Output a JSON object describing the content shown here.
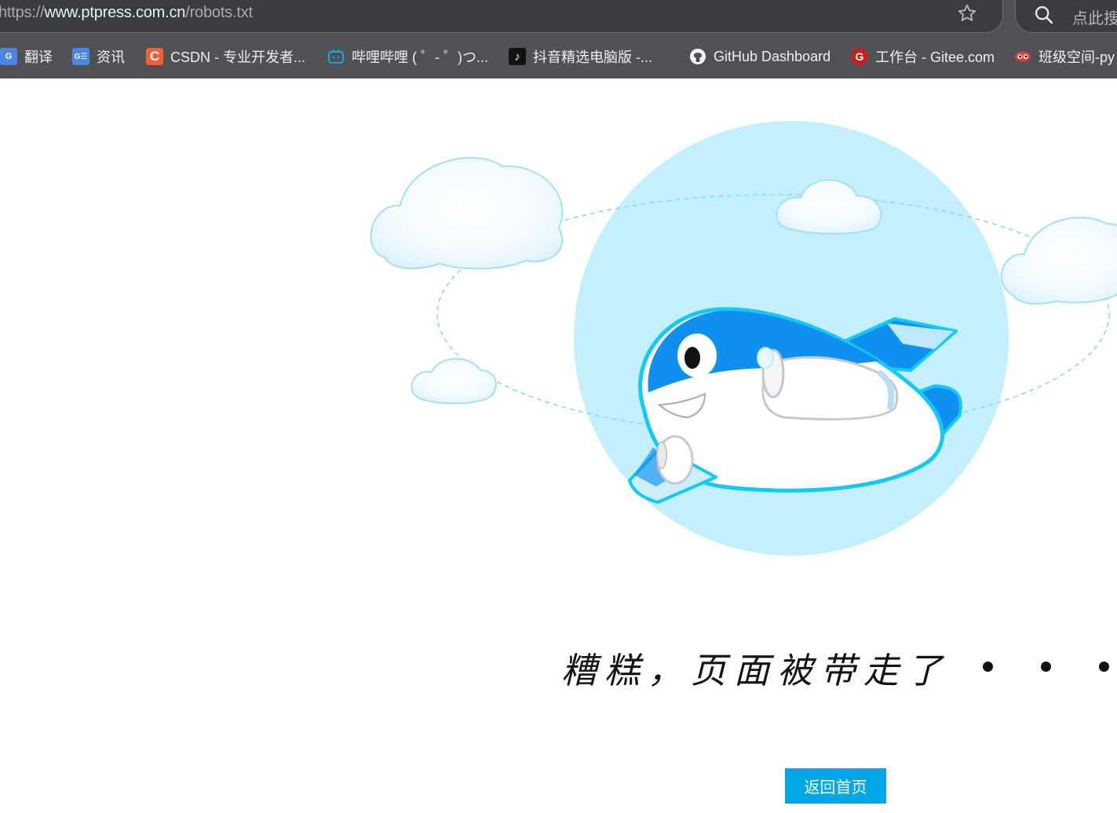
{
  "browser": {
    "url_scheme": "https://",
    "url_host": "www.ptpress.com.cn",
    "url_path": "/robots.txt",
    "search_placeholder": "点此搜"
  },
  "bookmarks": [
    {
      "label": "翻译",
      "icon": "google-translate-icon",
      "color": "#4a86e8"
    },
    {
      "label": "资讯",
      "icon": "google-news-icon",
      "color": "#4a86e8"
    },
    {
      "label": "CSDN - 专业开发者...",
      "icon": "csdn-icon",
      "color": "#f25f33"
    },
    {
      "label": "哔哩哔哩 ( ゜- ゜)つ...",
      "icon": "bilibili-icon",
      "color": "#00a1d6"
    },
    {
      "label": "抖音精选电脑版 -...",
      "icon": "douyin-icon",
      "color": "#111111"
    },
    {
      "label": "GitHub Dashboard",
      "icon": "github-icon",
      "color": "#ffffff"
    },
    {
      "label": "工作台 - Gitee.com",
      "icon": "gitee-icon",
      "color": "#c71d23"
    },
    {
      "label": "班级空间-py",
      "icon": "class-space-icon",
      "color": "#e63b3b"
    }
  ],
  "page": {
    "message": "糟糕，页面被带走了",
    "home_button": "返回首页"
  },
  "colors": {
    "accent": "#00a7e7",
    "illustration_bg": "#c4effd",
    "plane_blue": "#0f8ff0"
  }
}
